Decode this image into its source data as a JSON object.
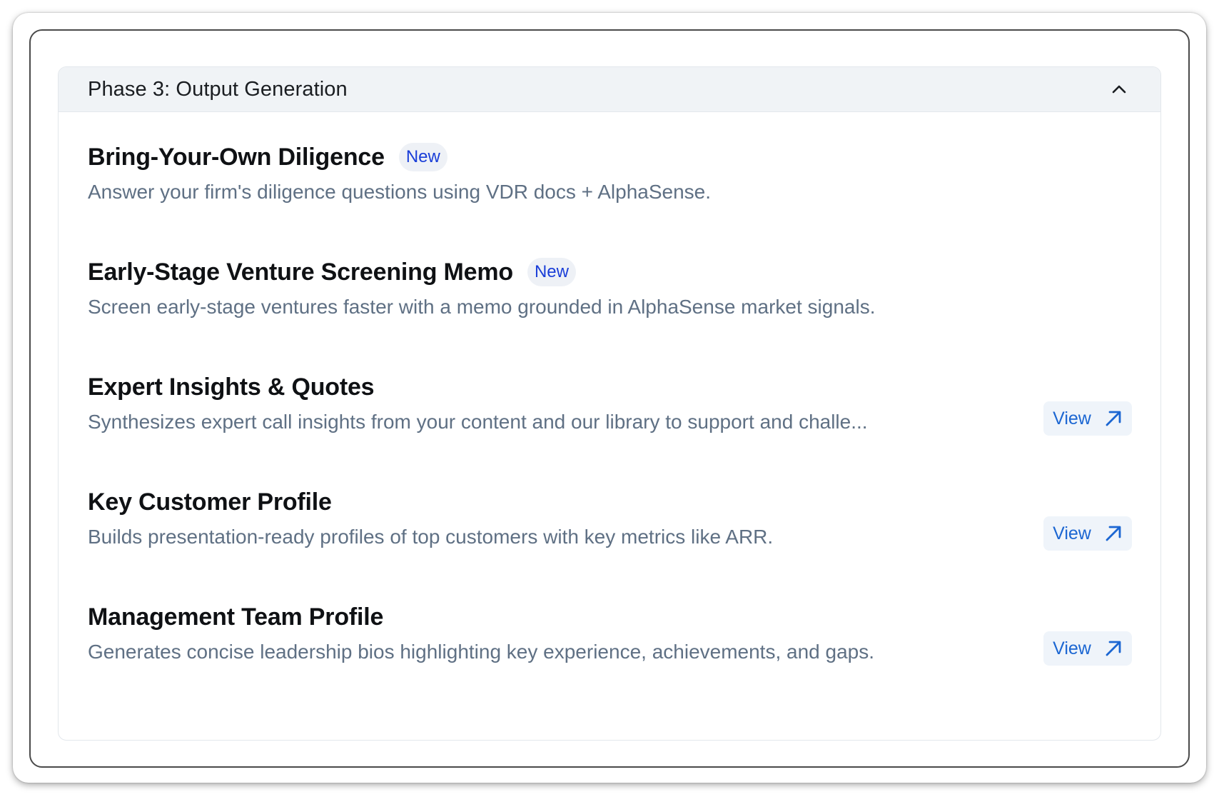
{
  "section": {
    "title": "Phase 3: Output Generation",
    "collapse_icon": "chevron-up-icon"
  },
  "items": [
    {
      "title": "Bring-Your-Own Diligence",
      "badge": "New",
      "description": "Answer your firm's diligence questions using VDR docs + AlphaSense.",
      "action": ""
    },
    {
      "title": "Early-Stage Venture Screening Memo",
      "badge": "New",
      "description": "Screen early-stage ventures faster with a memo grounded in AlphaSense market signals.",
      "action": ""
    },
    {
      "title": "Expert Insights & Quotes",
      "badge": "",
      "description": "Synthesizes expert call insights from your content and our library to support and challe...",
      "action": "View"
    },
    {
      "title": "Key Customer Profile",
      "badge": "",
      "description": "Builds presentation-ready profiles of top customers with key metrics like ARR.",
      "action": "View"
    },
    {
      "title": "Management Team Profile",
      "badge": "",
      "description": "Generates concise leadership bios highlighting key experience, achievements, and gaps.",
      "action": "View"
    }
  ],
  "colors": {
    "badge_text": "#1a3ed8",
    "view_text": "#1b66d2",
    "description_text": "#5f7084",
    "header_bg": "#f0f3f6"
  }
}
